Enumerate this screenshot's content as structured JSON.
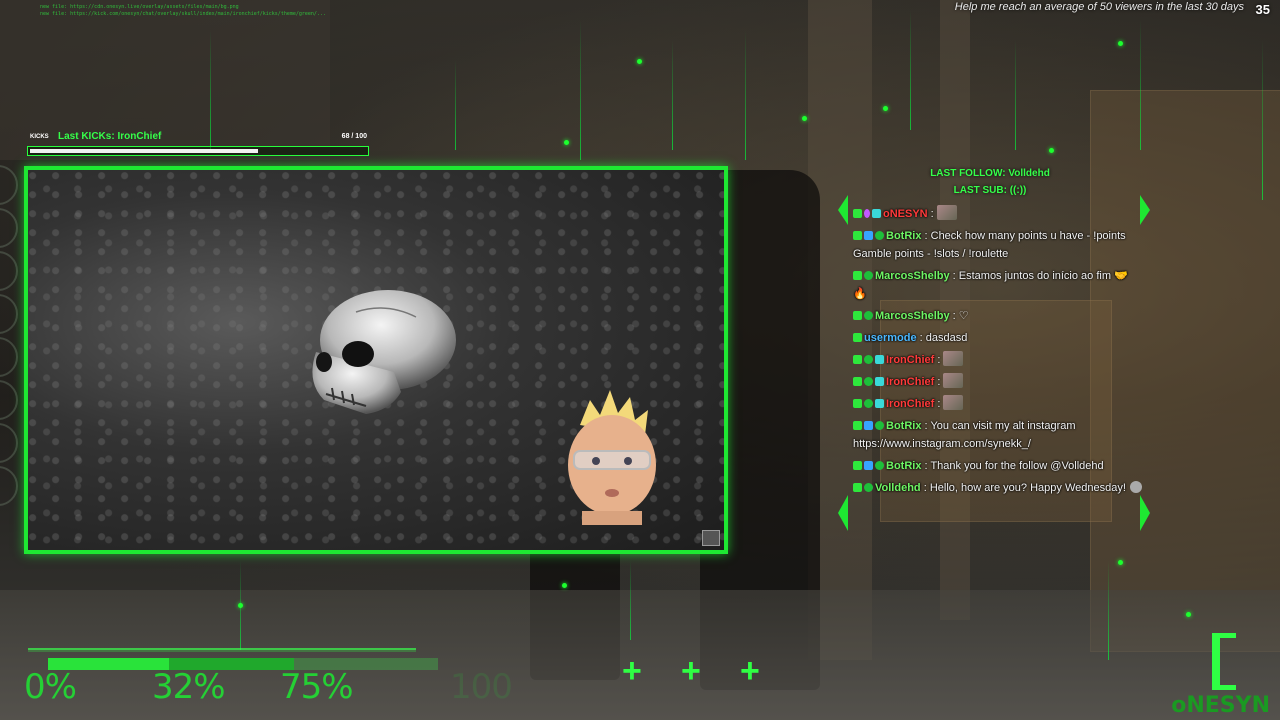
{
  "top_logs": [
    "new file: https://cdn.onesyn.live/overlay/assets/files/main/bg.png",
    "new file: https://kick.com/onesyn/chat/overlay/skull/index/main/ironchief/kicks/theme/green/..."
  ],
  "goal": {
    "text": "Help me reach an average of 50 viewers in the last 30 days",
    "count": "35"
  },
  "kicks": {
    "tag": "KICKS",
    "last_label": "Last KICKs: IronChief",
    "current": "68",
    "max": "/ 100",
    "progress": 0.68
  },
  "follow": {
    "last_follow": "LAST FOLLOW: Volldehd",
    "last_sub": "LAST SUB: ((:))"
  },
  "chat": [
    {
      "user": "oNESYN",
      "color": "red",
      "badges": [
        "kick",
        "gem",
        "sub"
      ],
      "text": "",
      "emote": true
    },
    {
      "user": "BotRix",
      "color": "green",
      "badges": [
        "kick",
        "mod",
        "verify"
      ],
      "text": "Check how many points u have - !points Gamble points - !slots / !roulette",
      "emote": false
    },
    {
      "user": "MarcosShelby",
      "color": "green",
      "badges": [
        "kick",
        "verify"
      ],
      "text": "Estamos juntos do início ao fim 🤝 🔥",
      "emote": false
    },
    {
      "user": "MarcosShelby",
      "color": "green",
      "badges": [
        "kick",
        "verify"
      ],
      "text": "♡",
      "emote": false
    },
    {
      "user": "usermode",
      "color": "blue",
      "badges": [
        "kick"
      ],
      "text": "dasdasd",
      "emote": false
    },
    {
      "user": "IronChief",
      "color": "red",
      "badges": [
        "kick",
        "verify",
        "sub"
      ],
      "text": "",
      "emote": true
    },
    {
      "user": "IronChief",
      "color": "red",
      "badges": [
        "kick",
        "verify",
        "sub"
      ],
      "text": "",
      "emote": true
    },
    {
      "user": "IronChief",
      "color": "red",
      "badges": [
        "kick",
        "verify",
        "sub"
      ],
      "text": "",
      "emote": true
    },
    {
      "user": "BotRix",
      "color": "green",
      "badges": [
        "kick",
        "mod",
        "verify"
      ],
      "text": "You can visit my alt instagram https://www.instagram.com/synekk_/",
      "emote": false
    },
    {
      "user": "BotRix",
      "color": "green",
      "badges": [
        "kick",
        "mod",
        "verify"
      ],
      "text": "Thank you for the follow @Volldehd",
      "emote": false
    },
    {
      "user": "Volldehd",
      "color": "green",
      "badges": [
        "kick",
        "verify"
      ],
      "text": "Hello, how are you? Happy Wednesday!",
      "emote": true
    }
  ],
  "hud": {
    "pct": [
      "0%",
      "32%",
      "75%",
      "100"
    ],
    "levels": [
      0.31,
      0.63
    ],
    "plus": [
      "+",
      "+",
      "+"
    ]
  },
  "brand": "oNESYN",
  "colors": {
    "accent": "#1ee832",
    "user_red": "#ff3a3a",
    "user_green": "#6ef564",
    "user_blue": "#4ab8ff"
  }
}
